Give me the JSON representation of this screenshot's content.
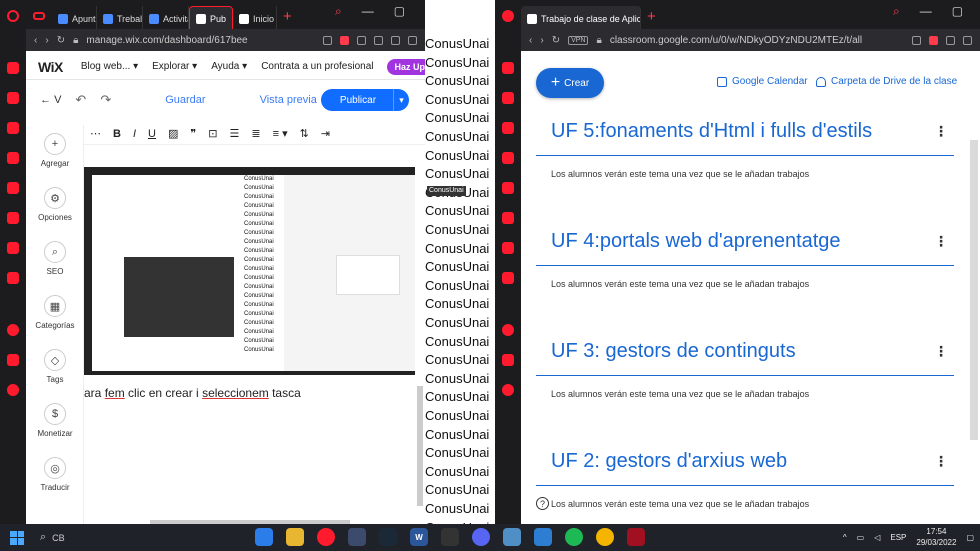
{
  "left_window": {
    "tabs": [
      {
        "label": "Apunts",
        "active": false
      },
      {
        "label": "Treball",
        "active": false
      },
      {
        "label": "Activitat",
        "active": false
      },
      {
        "label": "Pub",
        "active": true
      },
      {
        "label": "Inicio |",
        "active": false
      }
    ],
    "url": "manage.wix.com/dashboard/617bee",
    "wix": {
      "logo": "WiX",
      "site_name": "Blog web...",
      "menu": [
        "Explorar",
        "Ayuda",
        "Contrata a un profesional"
      ],
      "upgrade": "Haz Upg",
      "back": "V",
      "guardar": "Guardar",
      "vista_previa": "Vista previa",
      "publicar": "Publicar",
      "sidebar": [
        "Agregar",
        "Opciones",
        "SEO",
        "Categorías",
        "Tags",
        "Monetizar",
        "Traducir"
      ],
      "format": [
        "B",
        "I",
        "U"
      ],
      "caption_pre": "ara ",
      "caption_fem": "fem",
      "caption_mid": " clic en crear i ",
      "caption_sel": "seleccionem",
      "caption_post": " tasca"
    }
  },
  "middle": {
    "repeated_text": "ConusUnai",
    "overlay_text": "ConusUnai"
  },
  "right_window": {
    "tab_label": "Trabajo de clase de Aplicac",
    "url": "classroom.google.com/u/0/w/NDkyODYzNDU2MTEz/t/all",
    "vpn": "VPN",
    "crear": "Crear",
    "calendar": "Google Calendar",
    "drive": "Carpeta de Drive de la clase",
    "topics": [
      {
        "title": "UF 5:fonaments d'Html i fulls d'estils",
        "empty": "Los alumnos verán este tema una vez que se le añadan trabajos"
      },
      {
        "title": "UF 4:portals web d'aprenentatge",
        "empty": "Los alumnos verán este tema una vez que se le añadan trabajos"
      },
      {
        "title": "UF 3: gestors de continguts",
        "empty": "Los alumnos verán este tema una vez que se le añadan trabajos"
      },
      {
        "title": "UF 2: gestors d'arxius web",
        "empty": "Los alumnos verán este tema una vez que se le añadan trabajos"
      }
    ]
  },
  "taskbar": {
    "cb": "CB",
    "lang": "ESP",
    "time": "17:54",
    "date": "29/03/2022",
    "apps": [
      "opera",
      "edge",
      "explorer",
      "code",
      "steam",
      "word",
      "epic",
      "discord",
      "vbox",
      "grid",
      "spotify",
      "chrome",
      "game"
    ]
  }
}
